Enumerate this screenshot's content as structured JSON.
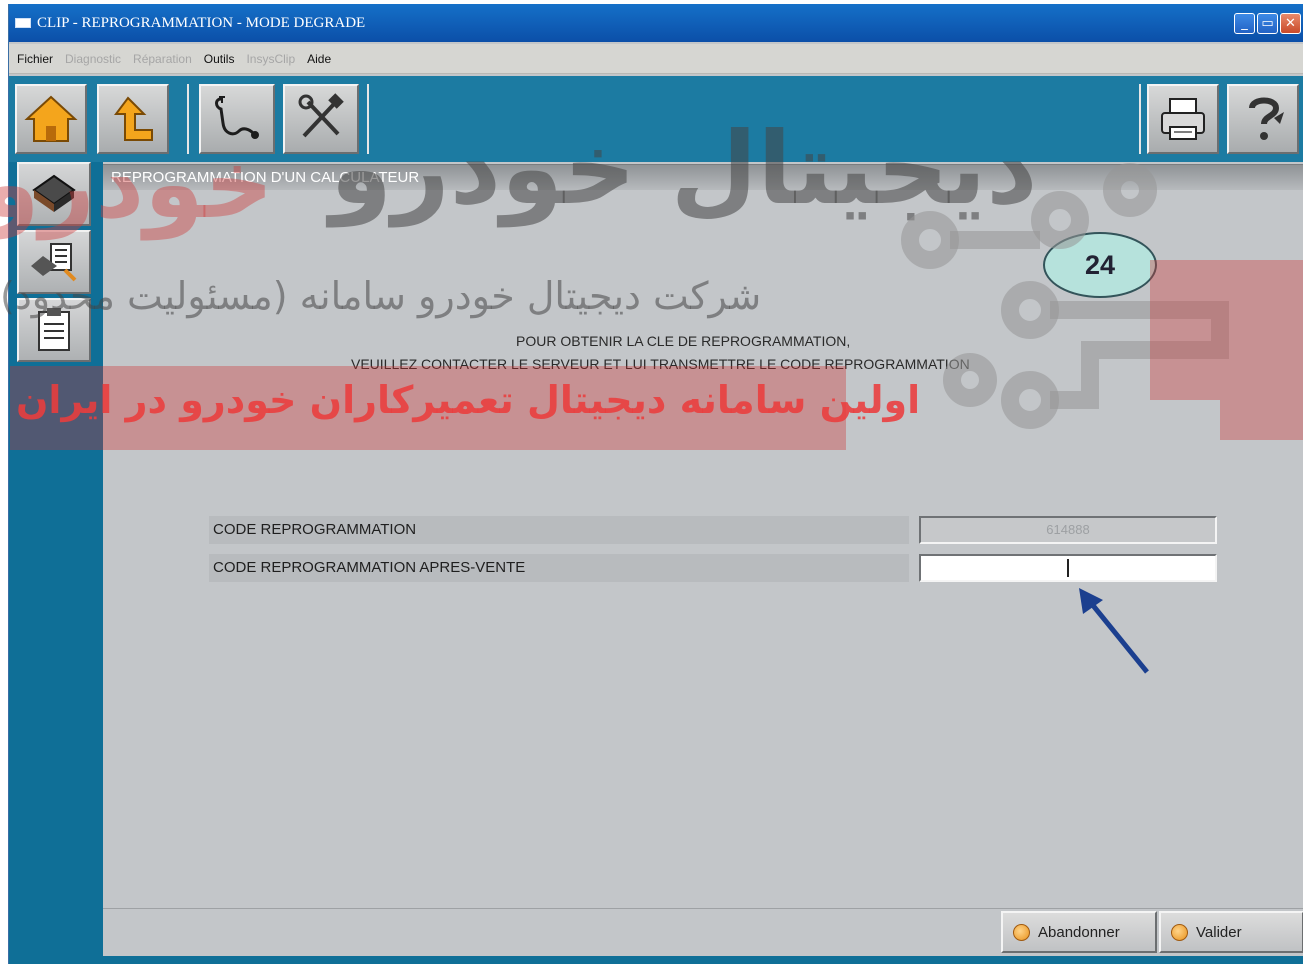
{
  "window": {
    "title": "CLIP - REPROGRAMMATION - MODE DEGRADE",
    "controls": {
      "minimize": "_",
      "restore": "▭",
      "close": "✕"
    }
  },
  "menu": [
    {
      "label": "Fichier",
      "enabled": true
    },
    {
      "label": "Diagnostic",
      "enabled": false
    },
    {
      "label": "Réparation",
      "enabled": false
    },
    {
      "label": "Outils",
      "enabled": true
    },
    {
      "label": "InsysClip",
      "enabled": false
    },
    {
      "label": "Aide",
      "enabled": true
    }
  ],
  "toolbar": {
    "left": [
      "home-icon",
      "up-level-icon",
      "diagnostic-probe-icon",
      "tools-icon"
    ],
    "right": [
      "printer-icon",
      "help-icon"
    ]
  },
  "sidebar": [
    "vehicle-ecu-icon",
    "ecu-list-icon",
    "clipboard-icon"
  ],
  "main": {
    "section_title": "REPROGRAMMATION D'UN CALCULATEUR",
    "step_number": "24",
    "instruction_line1": "POUR OBTENIR LA CLE DE REPROGRAMMATION,",
    "instruction_line2": "VEUILLEZ CONTACTER LE SERVEUR ET LUI TRANSMETTRE LE CODE REPROGRAMMATION",
    "fields": {
      "code_label": "CODE REPROGRAMMATION",
      "code_value": "614888",
      "after_sales_label": "CODE REPROGRAMMATION APRES-VENTE",
      "after_sales_value": ""
    }
  },
  "footer": {
    "cancel_label": "Abandonner",
    "validate_label": "Valider"
  },
  "watermark": {
    "brand": "دیجیتال خودرو",
    "company_line": "شرکت دیجیتال خودرو سامانه (مسئولیت محدود)",
    "tagline": "اولین سامانه دیجیتال تعمیرکاران خودرو در ایران"
  },
  "colors": {
    "title_bar": "#0b4fa8",
    "toolbar": "#1c7ba2",
    "sidebar": "#0f6f97",
    "panel": "#c3c6c9",
    "step_badge": "#b6e2dc",
    "arrow": "#1b3f8f",
    "watermark_red": "#cd3c3c"
  }
}
